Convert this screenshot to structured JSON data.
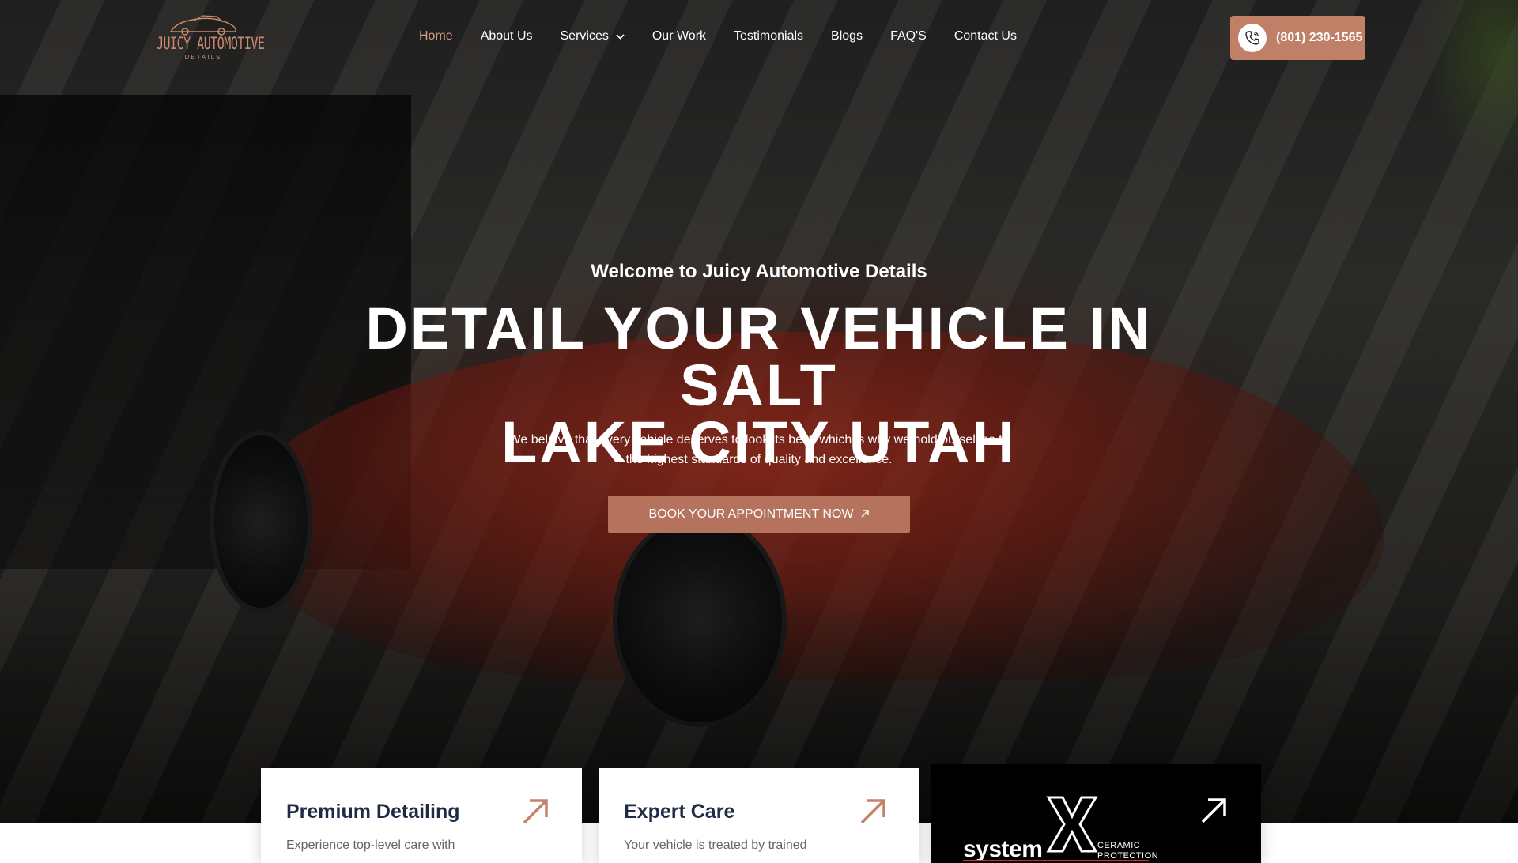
{
  "header": {
    "logo": {
      "main": "JUICY AUTOMOTIVE",
      "sub": "DETAILS"
    },
    "nav": [
      {
        "label": "Home",
        "active": true
      },
      {
        "label": "About Us"
      },
      {
        "label": "Services",
        "has_dropdown": true
      },
      {
        "label": "Our Work"
      },
      {
        "label": "Testimonials"
      },
      {
        "label": "Blogs"
      },
      {
        "label": "FAQ'S"
      },
      {
        "label": "Contact Us"
      }
    ],
    "phone": "(801) 230-1565",
    "phone_icon": "phone-icon"
  },
  "hero": {
    "welcome": "Welcome to Juicy Automotive Details",
    "headline_line1": "DETAIL YOUR VEHICLE IN SALT",
    "headline_line2": "LAKE CITY UTAH",
    "subtext_line1": "We believe that every vehicle deserves to look its best, which is why we hold ourselves to",
    "subtext_line2": "the highest standards of quality and excellence.",
    "cta_label": "BOOK YOUR APPOINTMENT NOW",
    "cta_icon": "arrow-up-right-icon"
  },
  "cards": [
    {
      "title": "Premium Detailing",
      "desc": "Experience top-level care with",
      "icon": "arrow-up-right-icon"
    },
    {
      "title": "Expert Care",
      "desc": "Your vehicle is treated by trained",
      "icon": "arrow-up-right-icon"
    }
  ],
  "brand_card": {
    "word": "system",
    "letter": "X",
    "tag1": "CERAMIC",
    "tag2": "PROTECTION",
    "icon": "arrow-up-right-icon"
  },
  "colors": {
    "accent": "#c08068",
    "cta": "#b5735d",
    "nav_active": "#d59a80",
    "card_title": "#1f2a44",
    "systemx_red": "#d22a2a"
  }
}
